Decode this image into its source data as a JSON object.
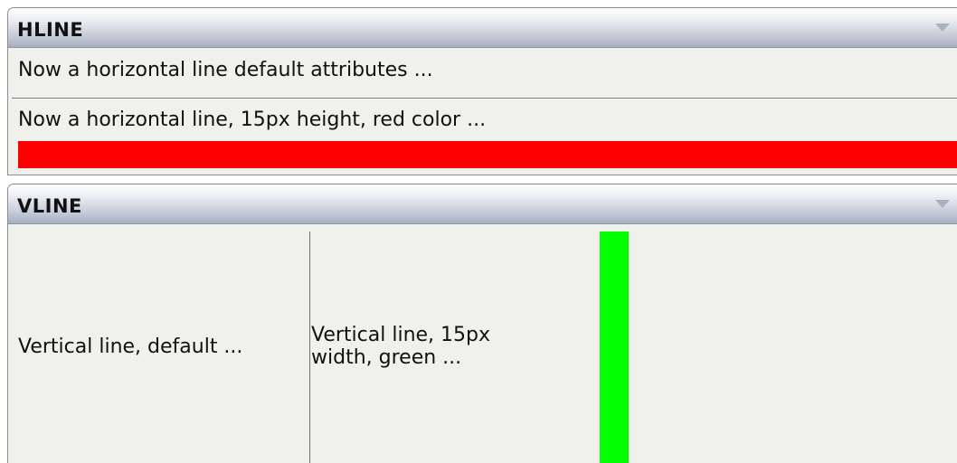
{
  "hline": {
    "title": "HLINE",
    "row1_text": "Now a horizontal line default attributes ...",
    "row2_text": "Now a horizontal line, 15px height, red color ...",
    "red_line_color": "#ff0000"
  },
  "vline": {
    "title": "VLINE",
    "cell1_text": "Vertical line, default ...",
    "cell2_line1": "Vertical line, 15px",
    "cell2_line2": "width, green ...",
    "green_line_color": "#00ff00"
  },
  "icons": {
    "collapse": "chevron-down-icon"
  }
}
